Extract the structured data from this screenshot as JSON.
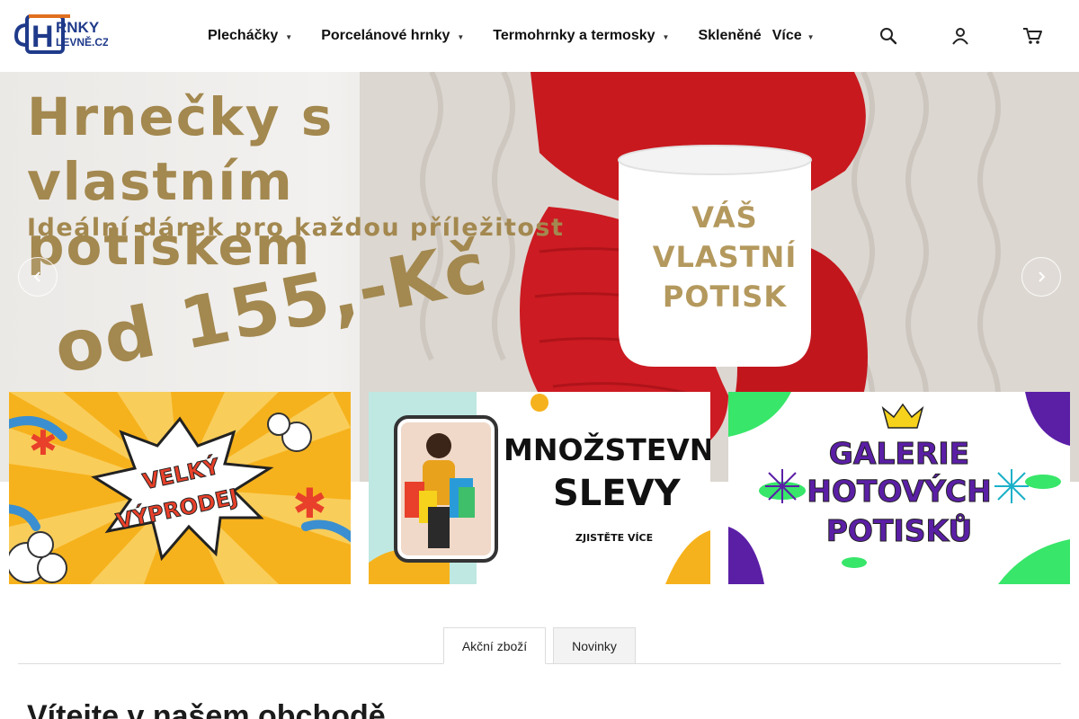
{
  "header": {
    "logo": {
      "line1": "RNKY",
      "line2": "LEVNĚ.CZ",
      "letter": "H"
    },
    "nav": [
      {
        "label": "Plecháčky",
        "has_dropdown": true
      },
      {
        "label": "Porcelánové hrnky",
        "has_dropdown": true
      },
      {
        "label": "Termohrnky a termosky",
        "has_dropdown": true
      },
      {
        "label": "Skleněné",
        "has_dropdown": false
      },
      {
        "label": "Více",
        "has_dropdown": true
      }
    ],
    "icons": [
      "search-icon",
      "user-icon",
      "cart-icon"
    ]
  },
  "hero": {
    "title": "Hrnečky s vlastním potiskem",
    "subtitle": "Ideální dárek pro každou příležitost",
    "price": "od 155,-Kč",
    "mug_text": [
      "VÁŠ",
      "VLASTNÍ",
      "POTISK"
    ],
    "prev_icon": "chevron-left-icon",
    "next_icon": "chevron-right-icon"
  },
  "banners": [
    {
      "name": "velky-vyprodej",
      "line1": "VELKÝ",
      "line2": "VÝPRODEJ",
      "bg": "#f6b21c"
    },
    {
      "name": "mnozstevni-slevy",
      "line1": "MNOŽSTEVNÍ",
      "line2": "SLEVY",
      "cta": "ZJISTĚTE VÍCE",
      "bg": "#ffffff"
    },
    {
      "name": "galerie-potisku",
      "line1": "GALERIE",
      "line2": "HOTOVÝCH",
      "line3": "POTISKŮ",
      "bg": "#ffffff"
    }
  ],
  "tabs": [
    {
      "label": "Akční zboží",
      "active": true
    },
    {
      "label": "Novinky",
      "active": false
    }
  ],
  "welcome": "Vítejte v našem obchodě",
  "colors": {
    "gold": "#a3884f",
    "navy": "#1f3a8a",
    "purple": "#5b1fa6",
    "green": "#38e66a",
    "yellow": "#f6b21c"
  }
}
